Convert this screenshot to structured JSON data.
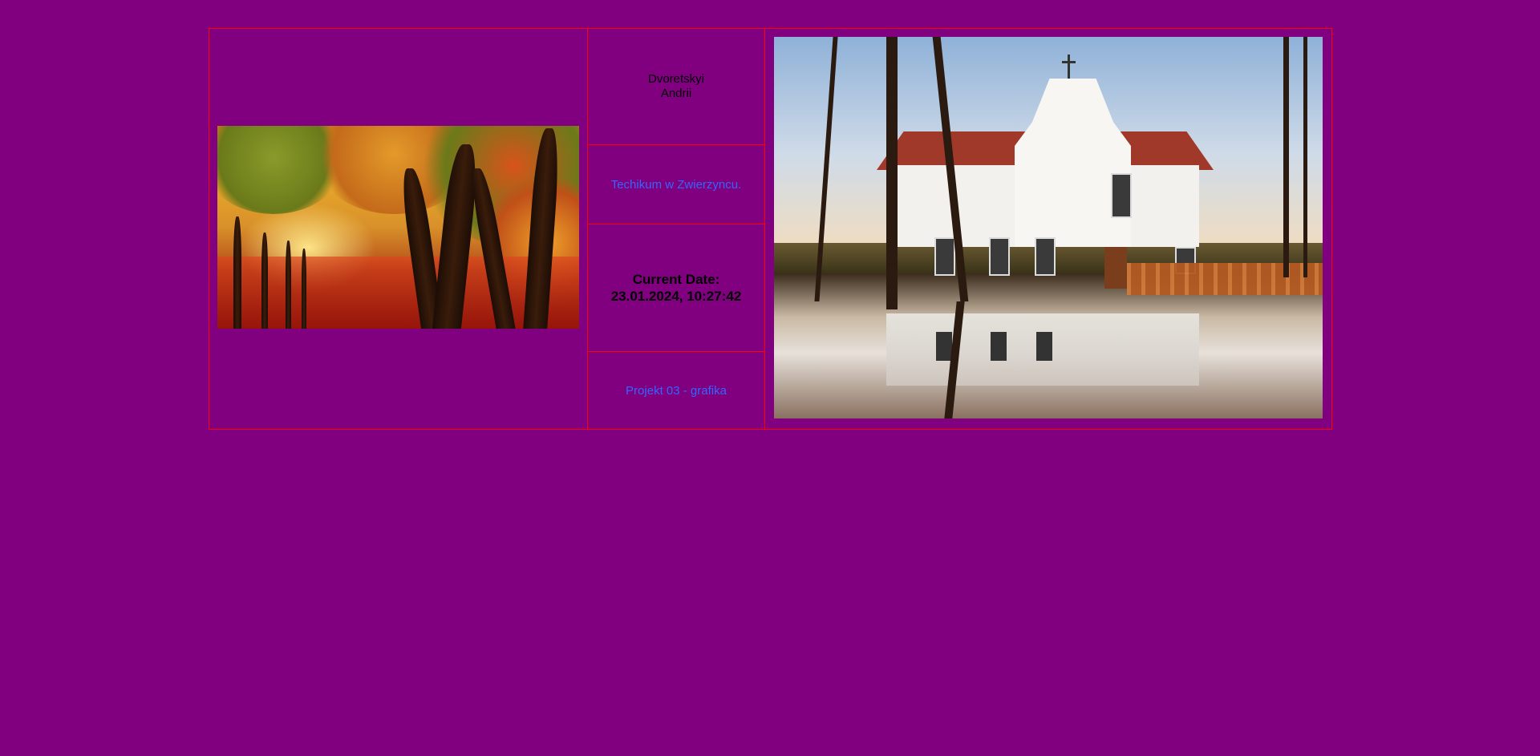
{
  "author": {
    "last_name": "Dvoretskyi",
    "first_name": "Andrii"
  },
  "school_link": "Techikum w Zwierzyncu.",
  "date_block": {
    "label": "Current Date:",
    "value": "23.01.2024, 10:27:42"
  },
  "project_link": "Projekt 03 - grafika",
  "colors": {
    "background": "#800080",
    "border": "#ff0000",
    "link": "#3366ff",
    "text": "#000000"
  }
}
